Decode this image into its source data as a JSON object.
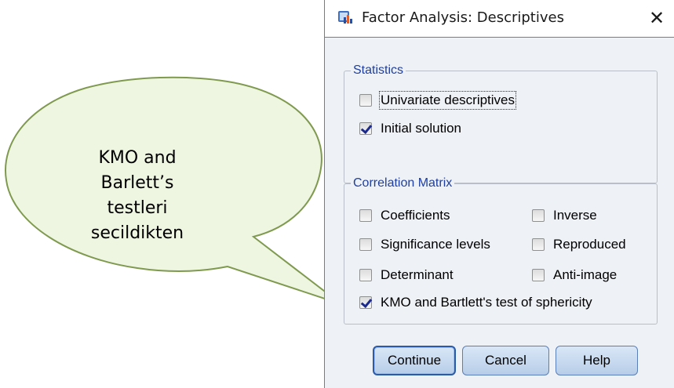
{
  "callout": {
    "lines": [
      "KMO and",
      "Barlett’s",
      "testleri",
      "secildikten"
    ]
  },
  "dialog": {
    "title": "Factor Analysis: Descriptives",
    "close_glyph": "✕",
    "statistics": {
      "legend": "Statistics",
      "items": [
        {
          "label": "Univariate descriptives",
          "checked": false
        },
        {
          "label": "Initial solution",
          "checked": true
        }
      ]
    },
    "correlation_matrix": {
      "legend": "Correlation Matrix",
      "items": [
        {
          "label": "Coefficients",
          "checked": false
        },
        {
          "label": "Inverse",
          "checked": false
        },
        {
          "label": "Significance levels",
          "checked": false
        },
        {
          "label": "Reproduced",
          "checked": false
        },
        {
          "label": "Determinant",
          "checked": false
        },
        {
          "label": "Anti-image",
          "checked": false
        },
        {
          "label": "KMO and Bartlett's test of sphericity",
          "checked": true
        }
      ]
    },
    "buttons": {
      "continue": "Continue",
      "cancel": "Cancel",
      "help": "Help"
    }
  },
  "colors": {
    "window_border": "#e04e5a",
    "callout_fill": "#eef6e2",
    "callout_stroke": "#7f9a4f",
    "legend_text": "#1f3f9f"
  }
}
